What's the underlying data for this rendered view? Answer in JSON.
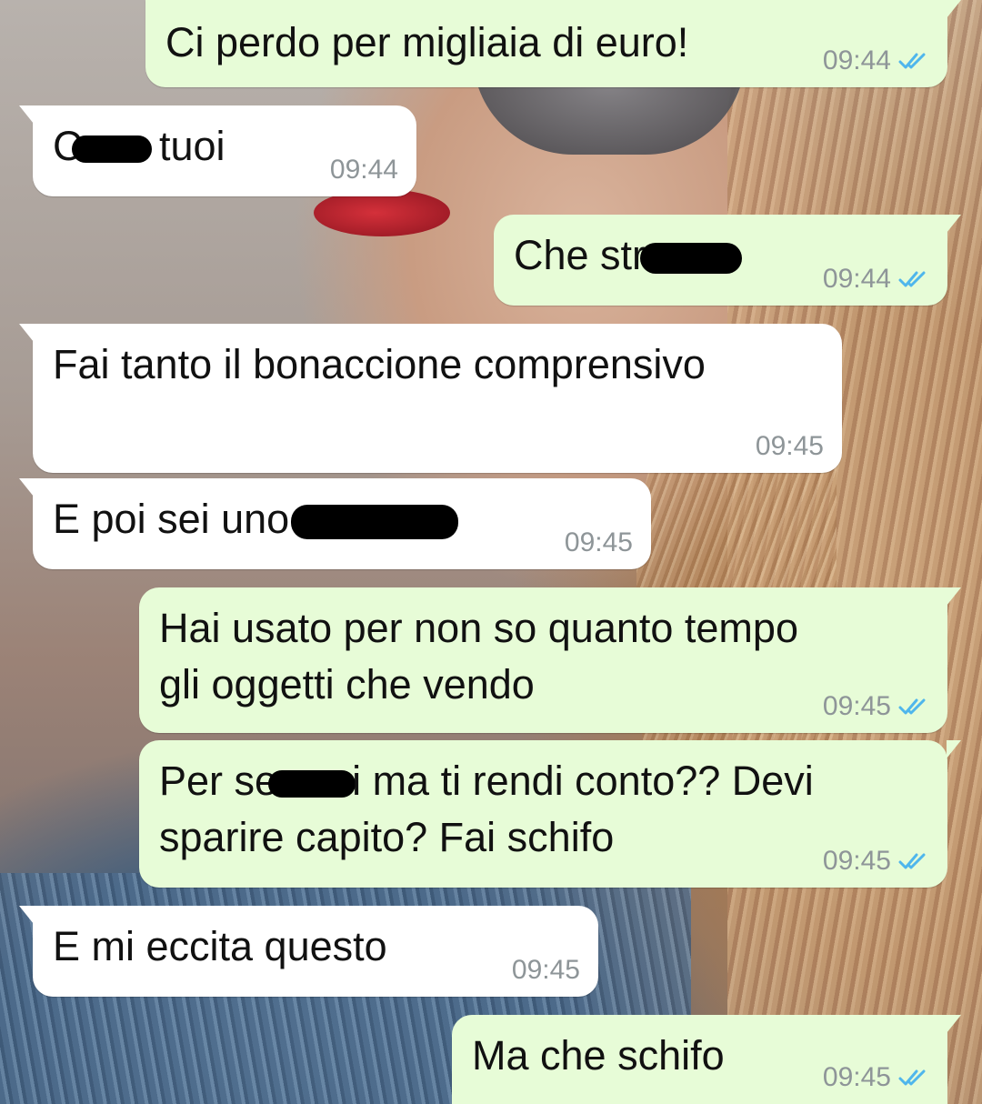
{
  "colors": {
    "outgoing_bubble": "#e7fcd7",
    "incoming_bubble": "#ffffff",
    "timestamp": "#8e9598",
    "read_ticks": "#4fb6ec"
  },
  "messages": [
    {
      "direction": "out",
      "text": "Ci perdo per migliaia di euro!",
      "time": "09:44",
      "status": "read"
    },
    {
      "direction": "in",
      "text_before": "C",
      "text_after": " tuoi",
      "redacted": true,
      "time": "09:44"
    },
    {
      "direction": "out",
      "text_before": "Che str",
      "text_after": "",
      "redacted": true,
      "time": "09:44",
      "status": "read"
    },
    {
      "direction": "in",
      "text": "Fai tanto il bonaccione comprensivo",
      "time": "09:45"
    },
    {
      "direction": "in",
      "text_before": "E poi sei uno",
      "text_after": "",
      "redacted": true,
      "time": "09:45"
    },
    {
      "direction": "out",
      "text": "Hai usato per non so quanto tempo\ngli oggetti che vendo",
      "time": "09:45",
      "status": "read"
    },
    {
      "direction": "out",
      "text_before": "Per se",
      "text_after": "i ma ti rendi conto?? Devi",
      "text_line2": "sparire capito? Fai schifo",
      "redacted": true,
      "time": "09:45",
      "status": "read"
    },
    {
      "direction": "in",
      "text": "E mi eccita questo",
      "time": "09:45"
    },
    {
      "direction": "out",
      "text": "Ma che schifo",
      "time": "09:45",
      "status": "read"
    }
  ]
}
